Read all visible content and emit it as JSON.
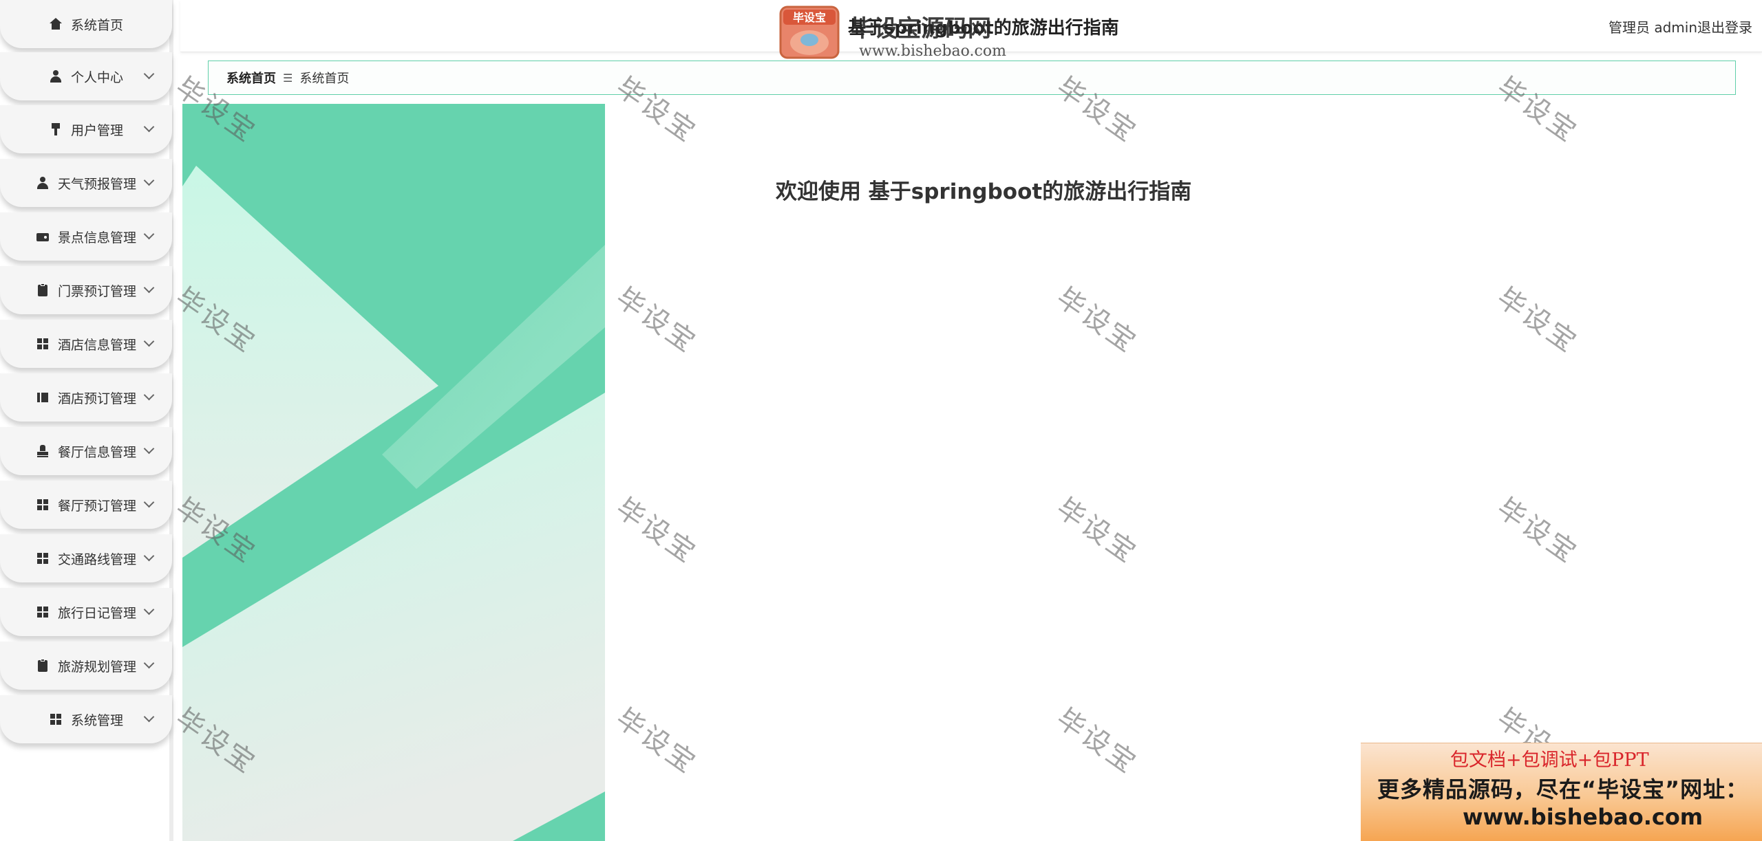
{
  "sidebar": {
    "items": [
      {
        "label": "系统首页",
        "icon": "home-icon",
        "has_chevron": false
      },
      {
        "label": "个人中心",
        "icon": "user-icon",
        "has_chevron": true
      },
      {
        "label": "用户管理",
        "icon": "pin-icon",
        "has_chevron": true
      },
      {
        "label": "天气预报管理",
        "icon": "user-icon",
        "has_chevron": true
      },
      {
        "label": "景点信息管理",
        "icon": "wallet-icon",
        "has_chevron": true
      },
      {
        "label": "门票预订管理",
        "icon": "clipboard-icon",
        "has_chevron": true
      },
      {
        "label": "酒店信息管理",
        "icon": "grid-icon",
        "has_chevron": true
      },
      {
        "label": "酒店预订管理",
        "icon": "book-icon",
        "has_chevron": true
      },
      {
        "label": "餐厅信息管理",
        "icon": "stamp-icon",
        "has_chevron": true
      },
      {
        "label": "餐厅预订管理",
        "icon": "grid-icon",
        "has_chevron": true
      },
      {
        "label": "交通路线管理",
        "icon": "grid-icon",
        "has_chevron": true
      },
      {
        "label": "旅行日记管理",
        "icon": "grid-icon",
        "has_chevron": true
      },
      {
        "label": "旅游规划管理",
        "icon": "clipboard-icon",
        "has_chevron": true
      },
      {
        "label": "系统管理",
        "icon": "grid-icon",
        "has_chevron": true
      }
    ]
  },
  "header": {
    "title": "基于springboot的旅游出行指南",
    "user": "管理员 admin",
    "logout": "退出登录"
  },
  "breadcrumb": {
    "home": "系统首页",
    "separator": "☰",
    "current": "系统首页"
  },
  "main": {
    "welcome": "欢迎使用 基于springboot的旅游出行指南"
  },
  "watermark": {
    "logo_text": "毕设宝源码网",
    "logo_badge": "毕设宝",
    "logo_url": "www.bishebao.com",
    "diagonal_text": "毕设宝"
  },
  "promo": {
    "line1": "包文档+包调试+包PPT",
    "line2": "更多精品源码，尽在“毕设宝”网址：",
    "line3": "www.bishebao.com"
  },
  "colors": {
    "accent": "#66d3ae",
    "light_accent": "#c9f7e6",
    "breadcrumb_border": "#5fcfa9",
    "promo_red": "#d9242a"
  }
}
